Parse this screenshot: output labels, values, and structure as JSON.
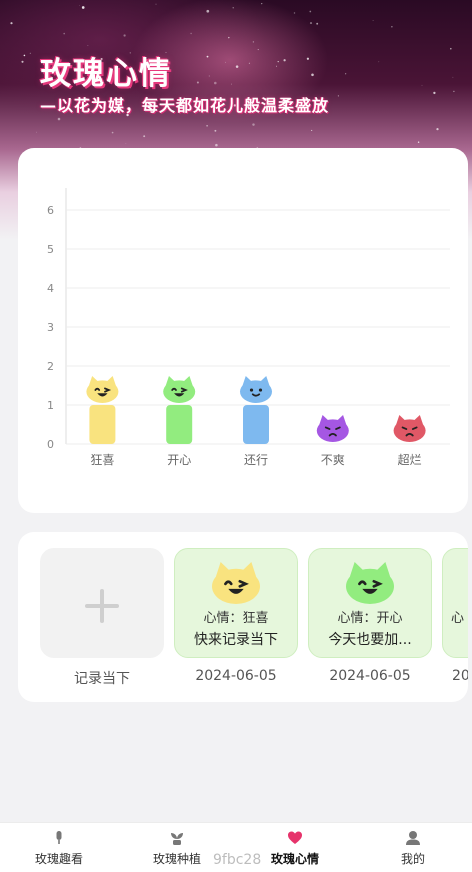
{
  "header": {
    "title": "玫瑰心情",
    "subtitle": "—以花为媒，每天都如花儿般温柔盛放"
  },
  "chart_data": {
    "type": "bar",
    "categories": [
      "狂喜",
      "开心",
      "还行",
      "不爽",
      "超烂"
    ],
    "values": [
      1,
      1,
      1,
      0,
      0
    ],
    "ylim": [
      0,
      6
    ],
    "yticks": [
      0,
      1,
      2,
      3,
      4,
      5,
      6
    ],
    "title": "",
    "xlabel": "",
    "ylabel": "",
    "grid": true,
    "bar_colors": [
      "#f9e37f",
      "#92ec7f",
      "#7eb9ef",
      "#a557e3",
      "#e05866"
    ],
    "face_icons": [
      "ecstatic-face-icon",
      "happy-face-icon",
      "okay-face-icon",
      "annoyed-face-icon",
      "terrible-face-icon"
    ]
  },
  "entries": {
    "add_label": "记录当下",
    "items": [
      {
        "mood_label": "心情：狂喜",
        "text": "快来记录当下",
        "date": "2024-06-05",
        "face_icon": "ecstatic-face-icon",
        "face_color": "#f9e37f"
      },
      {
        "mood_label": "心情：开心",
        "text": "今天也要加...",
        "date": "2024-06-05",
        "face_icon": "happy-face-icon",
        "face_color": "#92ec7f"
      },
      {
        "mood_label": "心",
        "text": "",
        "date": "20",
        "face_icon": "",
        "face_color": ""
      }
    ]
  },
  "tabbar": {
    "tabs": [
      {
        "label": "玫瑰趣看",
        "icon": "microphone-icon",
        "active": false
      },
      {
        "label": "玫瑰种植",
        "icon": "plant-icon",
        "active": false
      },
      {
        "label": "玫瑰心情",
        "icon": "heart-icon",
        "active": true
      },
      {
        "label": "我的",
        "icon": "user-icon",
        "active": false
      }
    ],
    "active_color": "#e6336b"
  },
  "watermark": "9fbc28"
}
